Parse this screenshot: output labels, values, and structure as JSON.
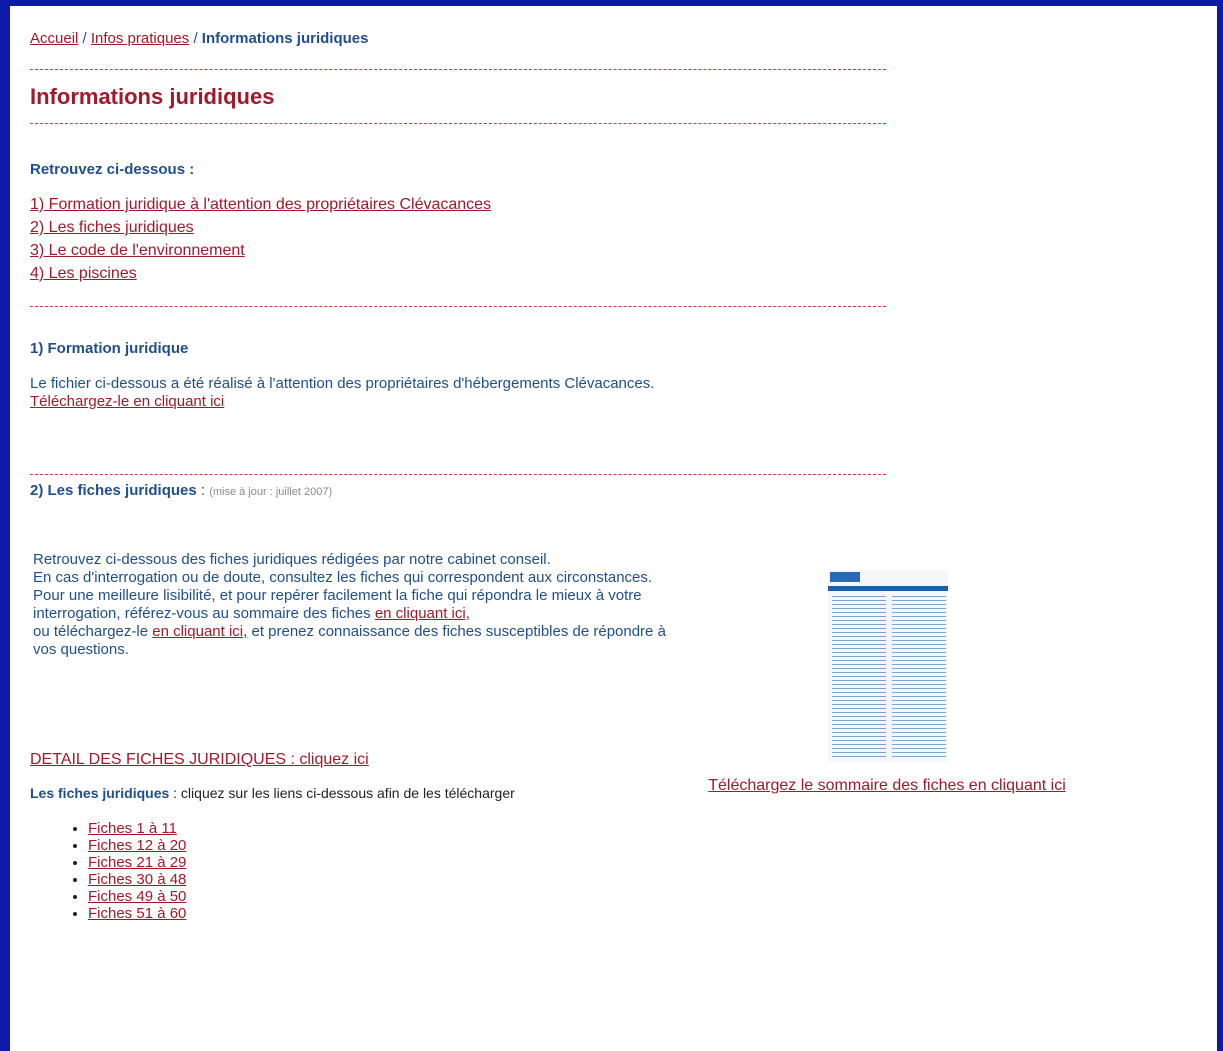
{
  "breadcrumb": {
    "home": "Accueil",
    "separator": "/",
    "section": "Infos pratiques",
    "current": "Informations juridiques"
  },
  "page_title": "Informations juridiques",
  "intro_heading": "Retrouvez ci-dessous :",
  "toc": [
    "1) Formation juridique à l'attention des propriétaires Clévacances",
    "2) Les fiches juridiques",
    "3) Le code de l'environnement",
    "4) Les piscines"
  ],
  "section1": {
    "heading": "1) Formation juridique",
    "text": "Le fichier ci-dessous a été réalisé à l'attention des propriétaires d'hébergements Clévacances.",
    "link": "Téléchargez-le en cliquant ici"
  },
  "section2": {
    "heading": "2) Les fiches juridiques",
    "colon": " : ",
    "note": "(mise à jour : juillet 2007)",
    "para1": "Retrouvez ci-dessous des fiches juridiques rédigées par notre cabinet conseil.",
    "para2": "En cas d'interrogation ou de doute, consultez les fiches qui correspondent aux circonstances.",
    "para3a": "Pour une meilleure lisibilité, et pour repérer facilement la fiche qui répondra le mieux à votre interrogation, référez-vous au sommaire des fiches ",
    "link_a": "en cliquant ici,",
    "para3b": "ou téléchargez-le ",
    "link_b": "en cliquant ici,",
    "para3c": " et prenez connaissance des fiches susceptibles de répondre à vos questions.",
    "thumb_caption": "Téléchargez le sommaire des fiches en cliquant ici",
    "detail_link": "DETAIL DES FICHES JURIDIQUES : cliquez ici",
    "list_intro_bold": "Les fiches juridiques",
    "list_intro_rest": " : cliquez sur les liens ci-dessous afin de les télécharger",
    "fiches": [
      "Fiches 1 à 11",
      "Fiches 12 à 20",
      "Fiches 21 à 29",
      "Fiches 30 à 48",
      "Fiches 49 à 50",
      "Fiches 51 à 60"
    ]
  }
}
